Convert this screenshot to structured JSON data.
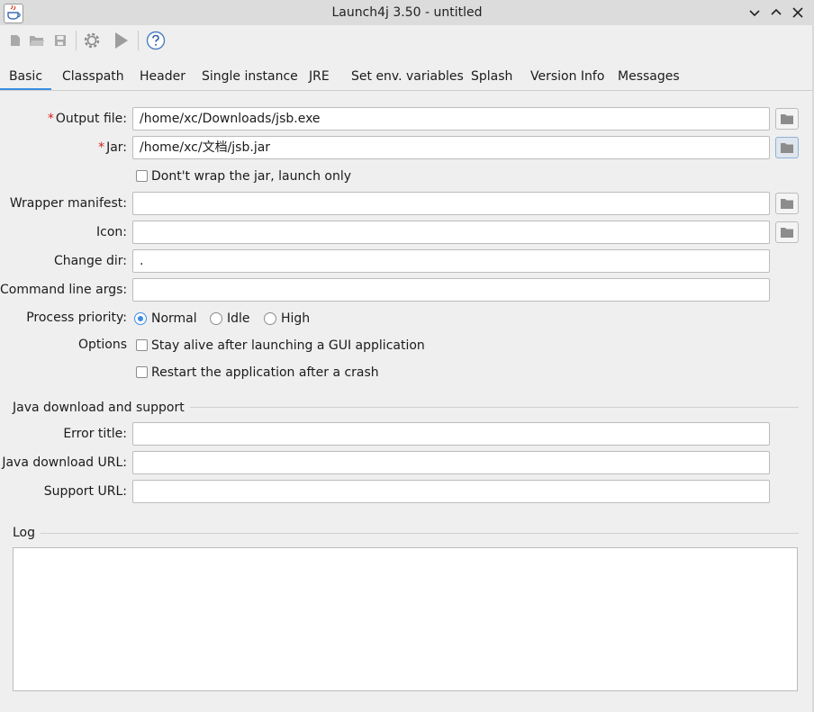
{
  "window": {
    "title": "Launch4j 3.50 - untitled",
    "controls": [
      "minimize",
      "maximize",
      "close"
    ]
  },
  "toolbar": {
    "buttons": [
      "new",
      "open",
      "save",
      "build-wrapper",
      "run",
      "help"
    ]
  },
  "tabs": [
    {
      "label": "Basic",
      "active": true
    },
    {
      "label": "Classpath"
    },
    {
      "label": "Header"
    },
    {
      "label": "Single instance"
    },
    {
      "label": "JRE"
    },
    {
      "label": "Set env. variables"
    },
    {
      "label": "Splash"
    },
    {
      "label": "Version Info"
    },
    {
      "label": "Messages"
    }
  ],
  "basic": {
    "output_file": {
      "label": "Output file:",
      "value": "/home/xc/Downloads/jsb.exe"
    },
    "jar": {
      "label": "Jar:",
      "value": "/home/xc/文档/jsb.jar"
    },
    "dont_wrap": {
      "label": "Dont't wrap the jar, launch only",
      "checked": false
    },
    "wrapper_manifest": {
      "label": "Wrapper manifest:",
      "value": ""
    },
    "icon": {
      "label": "Icon:",
      "value": ""
    },
    "change_dir": {
      "label": "Change dir:",
      "value": "."
    },
    "cmd_args": {
      "label": "Command line args:",
      "value": ""
    },
    "priority": {
      "label": "Process priority:",
      "options": [
        "Normal",
        "Idle",
        "High"
      ],
      "selected": "Normal"
    },
    "options": {
      "label": "Options",
      "stay_alive": {
        "label": "Stay alive after launching a GUI application",
        "checked": false
      },
      "restart": {
        "label": "Restart the application after a crash",
        "checked": false
      }
    },
    "java_download": {
      "section_title": "Java download and support",
      "error_title": {
        "label": "Error title:",
        "value": ""
      },
      "download_url": {
        "label": "Java download URL:",
        "value": ""
      },
      "support_url": {
        "label": "Support URL:",
        "value": ""
      }
    },
    "log": {
      "section_title": "Log",
      "content": ""
    }
  },
  "colors": {
    "accent": "#3d8ee3",
    "required": "#d71d1d",
    "background": "#efefef"
  }
}
